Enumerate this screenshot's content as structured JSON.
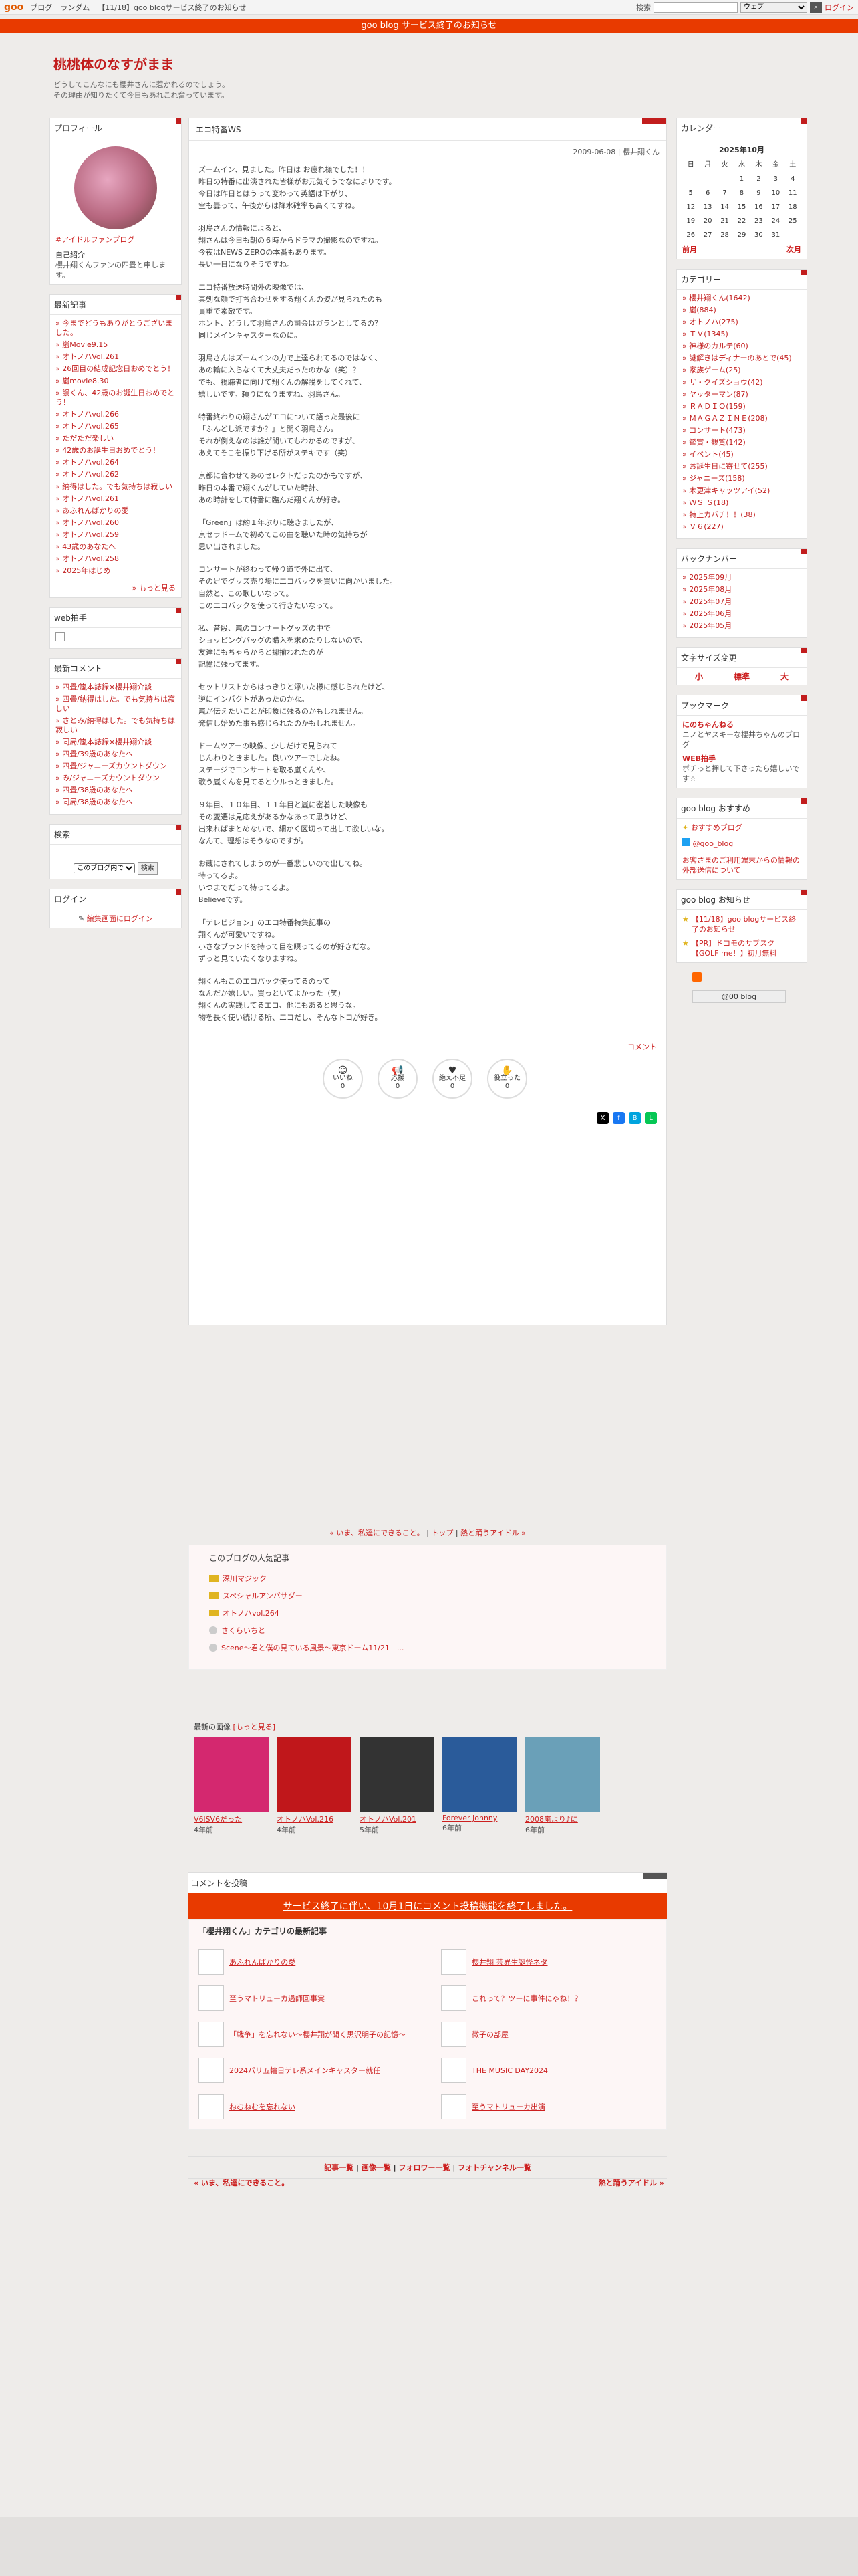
{
  "topbar": {
    "logo": "goo",
    "links": [
      "ブログ",
      "ランダム",
      "【11/18】goo blogサービス終了のお知らせ"
    ],
    "search_label": "検索",
    "select_value": "ウェブ",
    "login": "ログイン"
  },
  "notice": "goo blog サービス終了のお知らせ",
  "header": {
    "title": "桃桃体のなすがまま",
    "desc1": "どうしてこんなにも櫻井さんに惹かれるのでしょう。",
    "desc2": "その理由が知りたくて今日もあれこれ奮っています。"
  },
  "profile": {
    "heading": "プロフィール",
    "link": "#アイドルファンブログ",
    "intro_label": "自己紹介",
    "intro": "櫻井翔くんファンの四畳と申します。"
  },
  "recent": {
    "heading": "最新記事",
    "items": [
      "今までどうもありがとうございました。",
      "嵐Movie9.15",
      "オトノハVol.261",
      "26回目の結成記念日おめでとう！",
      "嵐movie8.30",
      "誤くん、42歳のお誕生日おめでとう！",
      "オトノハvol.266",
      "オトノハvol.265",
      "ただただ楽しい",
      "42歳のお誕生日おめでとう！",
      "オトノハvol.264",
      "オトノハvol.262",
      "納得はした。でも気持ちは寂しい",
      "オトノハvol.261",
      "あふれんばかりの愛",
      "オトノハvol.260",
      "オトノハvol.259",
      "43歳のあなたへ",
      "オトノハvol.258",
      "2025年はじめ"
    ],
    "more": "» もっと見る"
  },
  "webclap": {
    "heading": "web拍手"
  },
  "comments": {
    "heading": "最新コメント",
    "items": [
      "四畳/嵐本誌録×櫻井翔介談",
      "四畳/納得はした。でも気持ちは寂しい",
      "さとみ/納得はした。でも気持ちは寂しい",
      "同局/嵐本誌録×櫻井翔介談",
      "四畳/39歳のあなたへ",
      "四畳/ジャニーズカウントダウン",
      "み/ジャニーズカウントダウン",
      "四畳/38歳のあなたへ",
      "同局/38歳のあなたへ"
    ]
  },
  "search": {
    "heading": "検索",
    "select": "このブログ内で",
    "button": "検索"
  },
  "login": {
    "heading": "ログイン",
    "link": "編集画面にログイン"
  },
  "article": {
    "title": "エコ特番WS",
    "date": "2009-06-08 | 櫻井翔くん",
    "paragraphs": [
      "ズームイン、見ました。昨日は お疲れ様でした！！\n昨日の特番に出演された皆様がお元気そうでなによりです。\n今日は昨日とはうって変わって英語は下がり、\n空も曇って、午後からは降水確率も高くてすね。",
      "羽鳥さんの情報によると、\n翔さんは今日も朝の６時からドラマの撮影なのですね。\n今夜はNEWS ZEROの本番もあります。\n長い一日になりそうですね。",
      "エコ特番放送時間外の映像では、\n真剣な顔で打ち合わせをする翔くんの姿が見られたのも\n貴重で素敵です。\nホント、どうして羽鳥さんの司会はガランとしてるの？\n同じメインキャスターなのに。",
      "羽鳥さんはズームインの力で上達られてるのではなく、\nあの輪に入らなくて大丈夫だったのかな（笑）？\nでも、視聴者に向けて翔くんの解説をしてくれて、\n嬉しいです。頼りになりますね、羽鳥さん。",
      "特番終わりの翔さんがエコについて語った最後に\n「ふんどし派ですか？」と聞く羽鳥さん。\nそれが例えなのは誰が聞いてもわかるのですが、\nあえてそこを振り下げる所がステキです（笑）",
      "京都に合わせてあのセレクトだったのかもですが、\n昨日の本番で翔くんがしていた時計、\nあの時計をして特番に臨んだ翔くんが好き。",
      "「Green」は約１年ぶりに聴きましたが、\n京セラドームで初めてこの曲を聴いた時の気持ちが\n思い出されました。",
      "コンサートが終わって帰り道で外に出て、\nその足でグッズ売り場にエコバックを買いに向かいました。\n自然と、この歌しいなって。\nこのエコバックを使って行きたいなって。",
      "私、昔段、嵐のコンサートグッズの中で\nショッピングバッグの購入を求めたりしないので、\n友達にもちゃらからと揶揄われたのが\n記憶に残ってます。",
      "セットリストからはっきりと浮いた様に感じられたけど、\n逆にインパクトがあったのかな。\n嵐が伝えたいことが印象に残るのかもしれません。\n発信し始めた事も感じられたのかもしれません。",
      "ドームツアーの映像、少しだけで見られて\nじんわりときました。良いツアーでしたね。\nステージでコンサートを取る嵐くんや、\n歌う嵐くんを見てるとウルっときました。",
      "９年目、１０年目、１１年目と嵐に密着した映像も\nその変遷は見応えがあるかなあって思うけど、\n出来ればまとめないで、細かく区切って出して欲しいな。\nなんて、理想はそうなのですが。",
      "お蔵にされてしまうのが一番悲しいので出してね。\n待ってるよ。\nいつまでだって待ってるよ。\nBelieveです。",
      "「テレビジョン」のエコ特番特集記事の\n翔くんが可愛いですね。\n小さなブランドを持って目を瞑ってるのが好きだな。\nずっと見ていたくなりますね。",
      "翔くんもこのエコバック使ってるのって\nなんだか嬉しい。買っといてよかった（笑）\n翔くんの実践してるエコ、他にもあると思うな。\n物を長く使い続ける所、エコだし、そんなトコが好き。"
    ],
    "comment_label": "コメント",
    "reactions": [
      {
        "icon": "smile-icon",
        "label": "いいね",
        "count": "0"
      },
      {
        "icon": "megaphone-icon",
        "label": "応援",
        "count": "0"
      },
      {
        "icon": "heart-eyes-icon",
        "label": "絶え不足",
        "count": "0"
      },
      {
        "icon": "clap-icon",
        "label": "役立った",
        "count": "0"
      }
    ]
  },
  "pager": {
    "prev": "« いま、私達にできること。",
    "top": "トップ",
    "next": "熱と踊うアイドル »"
  },
  "popular": {
    "heading": "このブログの人気記事",
    "items": [
      "深川マジック",
      "スペシャルアンバサダー",
      "オトノハvol.264",
      "さくらいちと",
      "Scene〜君と僕の見ている風景〜東京ドーム11/21　..."
    ]
  },
  "images": {
    "label": "最新の画像",
    "more": "[もっと見る]",
    "items": [
      {
        "title": "V6lSV6だった",
        "age": "4年前"
      },
      {
        "title": "オトノハVol.216",
        "age": "4年前"
      },
      {
        "title": "オトノハVol.201",
        "age": "5年前"
      },
      {
        "title": "Forever Johnny",
        "age": "6年前"
      },
      {
        "title": "2008嵐より♪に",
        "age": "6年前"
      }
    ]
  },
  "comment_area": {
    "heading": "コメントを投稿",
    "end": "サービス終了に伴い、10月1日にコメント投稿機能を終了しました。"
  },
  "cat_latest": {
    "heading": "「櫻井翔くん」カテゴリの最新記事",
    "items": [
      "あふれんばかりの愛",
      "櫻井翔 芸界生誕怪ネタ",
      "至うマトリューカ過師回事実",
      "これって？ツーに事件にゃね！？",
      "「戦争」を忘れない〜櫻井翔が聞く黒沢明子の記憶〜",
      "微子の部屋",
      "2024パリ五輪日テレ系メインキャスター就任",
      "THE MUSIC DAY2024",
      "ねむねむを忘れない",
      "至うマトリューカ出演"
    ]
  },
  "bottom": {
    "links": [
      "記事一覧",
      "画像一覧",
      "フォロワー一覧",
      "フォトチャンネル一覧"
    ],
    "prev": "« いま、私達にできること。",
    "next": "熱と踊うアイドル »"
  },
  "calendar": {
    "heading": "カレンダー",
    "month": "2025年10月",
    "days": [
      "日",
      "月",
      "火",
      "水",
      "木",
      "金",
      "土"
    ],
    "rows": [
      [
        "",
        "",
        "",
        "1",
        "2",
        "3",
        "4"
      ],
      [
        "5",
        "6",
        "7",
        "8",
        "9",
        "10",
        "11"
      ],
      [
        "12",
        "13",
        "14",
        "15",
        "16",
        "17",
        "18"
      ],
      [
        "19",
        "20",
        "21",
        "22",
        "23",
        "24",
        "25"
      ],
      [
        "26",
        "27",
        "28",
        "29",
        "30",
        "31",
        ""
      ]
    ],
    "prev": "前月",
    "next": "次月"
  },
  "category": {
    "heading": "カテゴリー",
    "items": [
      "櫻井翔くん(1642)",
      "嵐(884)",
      "オトノハ(275)",
      "ＴＶ(1345)",
      "神様のカルテ(60)",
      "謎解きはディナーのあとで(45)",
      "家族ゲーム(25)",
      "ザ・クイズショウ(42)",
      "ヤッターマン(87)",
      "ＲＡＤＩＯ(159)",
      "ＭＡＧＡＺＩＮＥ(208)",
      "コンサート(473)",
      "鑑賞・観覧(142)",
      "イベント(45)",
      "お誕生日に寄せて(255)",
      "ジャニーズ(158)",
      "木更津キャッツアイ(52)",
      "ＷＳ Ｓ(18)",
      "特上カバチ！！(38)",
      "Ｖ６(227)"
    ]
  },
  "backnumber": {
    "heading": "バックナンバー",
    "items": [
      "2025年09月",
      "2025年08月",
      "2025年07月",
      "2025年06月",
      "2025年05月"
    ]
  },
  "fontsize": {
    "heading": "文字サイズ変更",
    "items": [
      "小",
      "標準",
      "大"
    ]
  },
  "bookmark": {
    "heading": "ブックマーク",
    "items": [
      {
        "title": "にのちゃんねる",
        "desc": "ニノとヤスキーな櫻井ちゃんのブログ"
      },
      {
        "title": "WEB拍手",
        "desc": "ポチっと押して下さったら嬉しいです☆"
      }
    ]
  },
  "goo_rec": {
    "heading": "goo blog おすすめ",
    "items": [
      "おすすめブログ",
      "@goo_blog"
    ],
    "notice": "お客さまのご利用端末からの情報の外部送信について"
  },
  "goo_notice": {
    "heading": "goo blog お知らせ",
    "items": [
      "【11/18】goo blogサービス終了のお知らせ",
      "【PR】ドコモのサブスク【GOLF me！】初月無料"
    ]
  },
  "goo_badge": "@00 blog"
}
